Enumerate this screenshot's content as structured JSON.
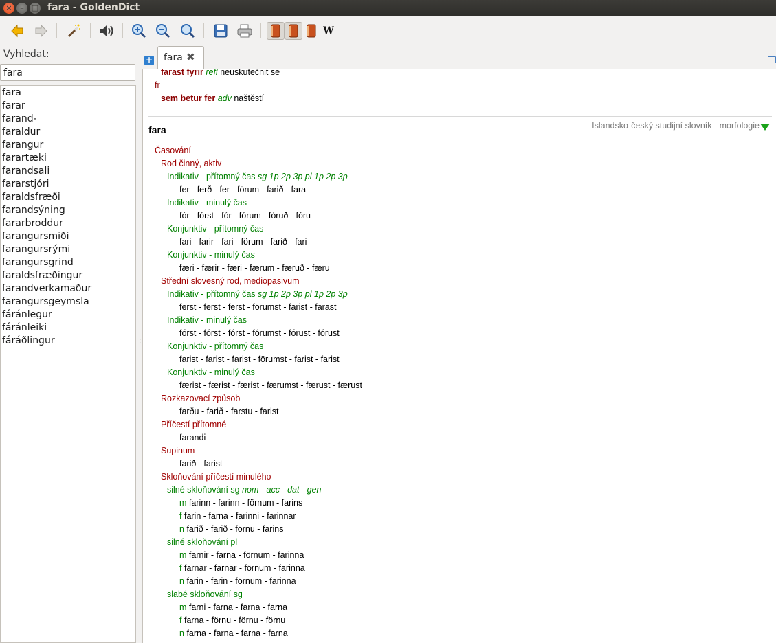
{
  "window": {
    "title": "fara - GoldenDict",
    "close_glyph": "×",
    "min_glyph": "–",
    "max_glyph": "□"
  },
  "toolbar": {
    "icons": [
      "back-icon",
      "forward-icon",
      "scan-popup-icon",
      "pronounce-icon",
      "zoom-in-icon",
      "zoom-out-icon",
      "zoom-normal-icon",
      "save-icon",
      "print-icon",
      "dictionary-book-icon",
      "dictionary-book-icon",
      "dictionary-book-icon",
      "wikipedia-icon"
    ],
    "wikipedia_glyph": "W"
  },
  "search": {
    "label": "Vyhledat:",
    "value": "fara"
  },
  "word_list": [
    "fara",
    "farar",
    "farand-",
    "faraldur",
    "farangur",
    "farartæki",
    "farandsali",
    "fararstjóri",
    "faraldsfræði",
    "farandsýning",
    "fararbroddur",
    "farangursmiði",
    "farangursrými",
    "farangursgrind",
    "faraldsfræðingur",
    "farandverkamaður",
    "farangursgeymsla",
    "fáránlegur",
    "fáránleiki",
    "fáráðlingur"
  ],
  "tabs": [
    {
      "label": "fara",
      "close_glyph": "✖"
    }
  ],
  "new_tab_glyph": "+",
  "article": {
    "prev_entry": {
      "line1_phrase": "farast fyrir",
      "line1_gram": "refl",
      "line1_trans": "neuskutečnit se",
      "link": "fr",
      "line2_phrase": "sem betur fer",
      "line2_gram": "adv",
      "line2_trans": "naštěstí"
    },
    "headword": "fara",
    "dictionary_name": "Islandsko-český studijní slovník - morfologie",
    "rows": [
      {
        "level": 1,
        "text": "Časování"
      },
      {
        "level": 1.5,
        "text": "Rod činný, aktiv"
      },
      {
        "level": 2,
        "text": "Indikativ - přítomný čas",
        "gram": "sg 1p 2p 3p pl 1p 2p 3p"
      },
      {
        "level": 3,
        "text": "fer - ferð - fer - förum - farið - fara"
      },
      {
        "level": 2,
        "text": "Indikativ - minulý čas"
      },
      {
        "level": 3,
        "text": "fór - fórst - fór - fórum - fóruð - fóru"
      },
      {
        "level": 2,
        "text": "Konjunktiv - přítomný čas"
      },
      {
        "level": 3,
        "text": "fari - farir - fari - förum - farið - fari"
      },
      {
        "level": 2,
        "text": "Konjunktiv - minulý čas"
      },
      {
        "level": 3,
        "text": "færi - færir - færi - færum - færuð - færu"
      },
      {
        "level": 1.5,
        "text": "Střední slovesný rod, mediopasivum"
      },
      {
        "level": 2,
        "text": "Indikativ - přítomný čas",
        "gram": "sg 1p 2p 3p pl 1p 2p 3p"
      },
      {
        "level": 3,
        "text": "ferst - ferst - ferst - förumst - farist - farast"
      },
      {
        "level": 2,
        "text": "Indikativ - minulý čas"
      },
      {
        "level": 3,
        "text": "fórst - fórst - fórst - fórumst - fórust - fórust"
      },
      {
        "level": 2,
        "text": "Konjunktiv - přítomný čas"
      },
      {
        "level": 3,
        "text": "farist - farist - farist - förumst - farist - farist"
      },
      {
        "level": 2,
        "text": "Konjunktiv - minulý čas"
      },
      {
        "level": 3,
        "text": "færist - færist - færist - færumst - færust - færust"
      },
      {
        "level": 1.5,
        "text": "Rozkazovací způsob"
      },
      {
        "level": 3,
        "text": "farðu - farið - farstu - farist"
      },
      {
        "level": 1.5,
        "text": "Příčestí přítomné"
      },
      {
        "level": 3,
        "text": "farandi"
      },
      {
        "level": 1.5,
        "text": "Supinum"
      },
      {
        "level": 3,
        "text": "farið - farist"
      },
      {
        "level": 1.5,
        "text": "Skloňování příčestí minulého"
      },
      {
        "level": 2,
        "text": "silné skloňování sg",
        "gram": "nom - acc - dat - gen"
      },
      {
        "level": 3,
        "prefix": "m",
        "text": "farinn - farinn - förnum - farins"
      },
      {
        "level": 3,
        "prefix": "f",
        "text": "farin - farna - farinni - farinnar"
      },
      {
        "level": 3,
        "prefix": "n",
        "text": "farið - farið - förnu - farins"
      },
      {
        "level": 2,
        "text": "silné skloňování pl"
      },
      {
        "level": 3,
        "prefix": "m",
        "text": "farnir - farna - förnum - farinna"
      },
      {
        "level": 3,
        "prefix": "f",
        "text": "farnar - farnar - förnum - farinna"
      },
      {
        "level": 3,
        "prefix": "n",
        "text": "farin - farin - förnum - farinna"
      },
      {
        "level": 2,
        "text": "slabé skloňování sg"
      },
      {
        "level": 3,
        "prefix": "m",
        "text": "farni - farna - farna - farna"
      },
      {
        "level": 3,
        "prefix": "f",
        "text": "farna - förnu - förnu - förnu"
      },
      {
        "level": 3,
        "prefix": "n",
        "text": "farna - farna - farna - farna"
      }
    ]
  }
}
